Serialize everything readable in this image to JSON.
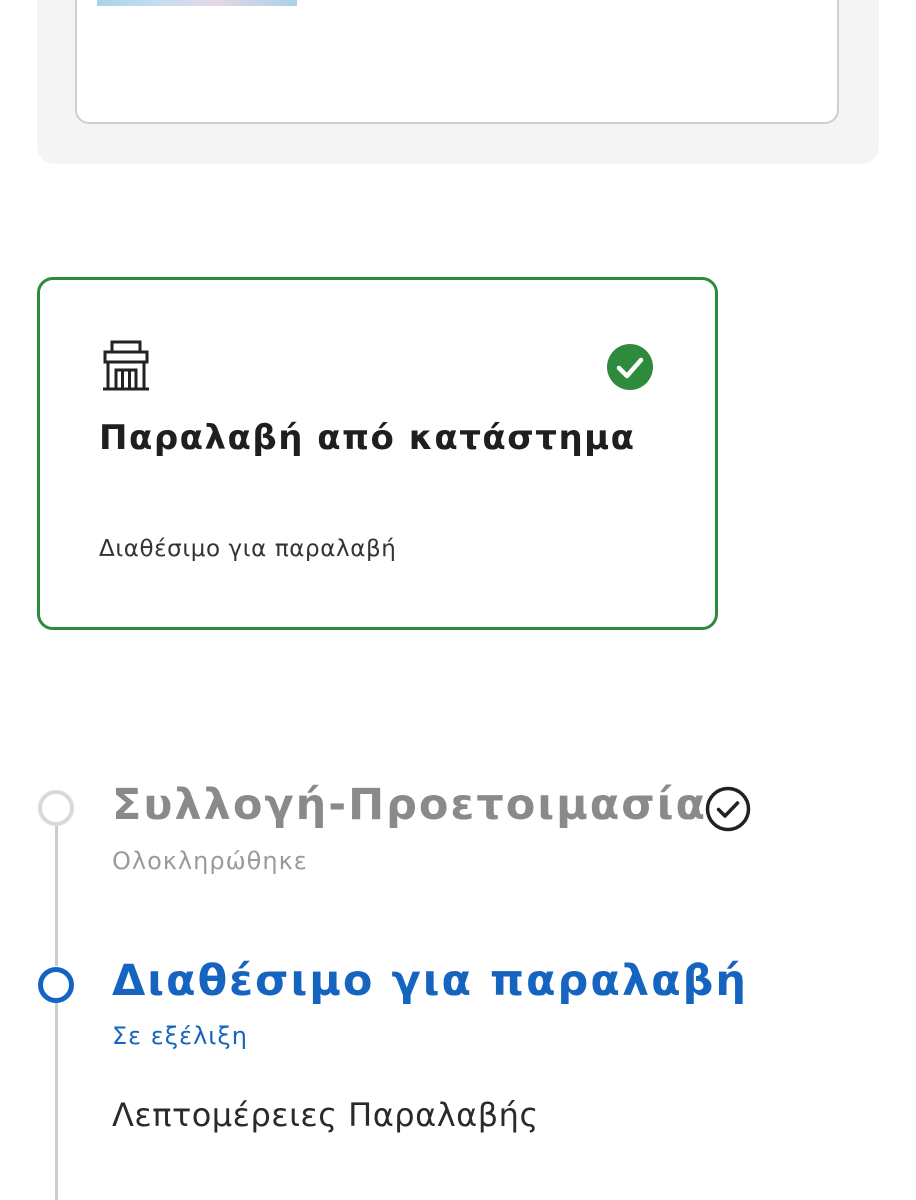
{
  "top_panel": {
    "thumbnail": "product-image"
  },
  "pickup_option": {
    "icon": "store-icon",
    "selected_icon": "check-circle-icon",
    "title": "Παραλαβή από κατάστημα",
    "subtitle": "Διαθέσιμο για παραλαβή",
    "accent_color": "#2e8b3d"
  },
  "timeline": {
    "steps": [
      {
        "title": "Συλλογή-Προετοιμασία",
        "status": "Ολοκληρώθηκε",
        "icon": "check-circle-outline-icon",
        "color": "#8a8a8a"
      },
      {
        "title": "Διαθέσιμο για παραλαβή",
        "status": "Σε εξέλιξη",
        "color": "#1565c0"
      }
    ],
    "details_label": "Λεπτομέρειες Παραλαβής"
  }
}
